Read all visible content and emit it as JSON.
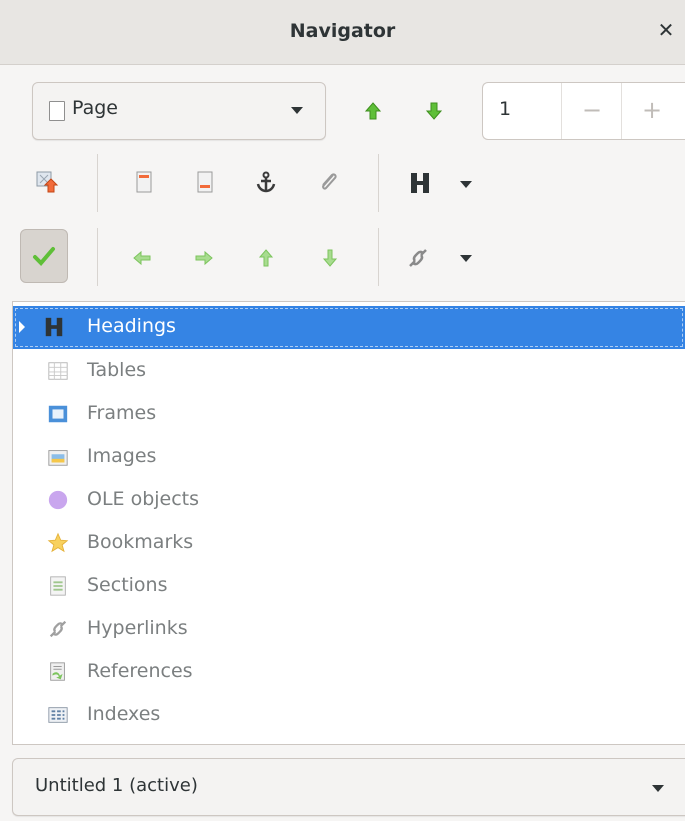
{
  "window": {
    "title": "Navigator",
    "close_icon": "close-icon"
  },
  "toolbar1": {
    "navigate_by": {
      "selected": "Page",
      "icon": "page-checkbox-icon"
    },
    "previous_icon": "arrow-up-green-icon",
    "next_icon": "arrow-down-green-icon",
    "page_number": "1",
    "decrement_label": "−",
    "increment_label": "+"
  },
  "toolbar2": {
    "icons": [
      "drag-mode-icon",
      "header-icon",
      "footer-icon",
      "anchor-icon",
      "paperclip-icon",
      "heading-level-icon"
    ]
  },
  "toolbar3": {
    "icons": [
      "toggle-content-check-icon",
      "promote-chapter-icon",
      "demote-chapter-icon",
      "promote-level-icon",
      "demote-level-icon",
      "hyperlink-mode-icon"
    ]
  },
  "tree": {
    "items": [
      {
        "label": "Headings",
        "icon": "headings-icon",
        "selected": true
      },
      {
        "label": "Tables",
        "icon": "tables-icon"
      },
      {
        "label": "Frames",
        "icon": "frames-icon"
      },
      {
        "label": "Images",
        "icon": "images-icon"
      },
      {
        "label": "OLE objects",
        "icon": "ole-objects-icon"
      },
      {
        "label": "Bookmarks",
        "icon": "bookmark-star-icon"
      },
      {
        "label": "Sections",
        "icon": "sections-icon"
      },
      {
        "label": "Hyperlinks",
        "icon": "hyperlinks-icon"
      },
      {
        "label": "References",
        "icon": "references-icon"
      },
      {
        "label": "Indexes",
        "icon": "indexes-icon"
      }
    ]
  },
  "document_selector": {
    "selected": "Untitled 1 (active)"
  },
  "colors": {
    "selection": "#3584e4",
    "green_arrow": "#5fbf38",
    "background": "#f6f5f4"
  }
}
